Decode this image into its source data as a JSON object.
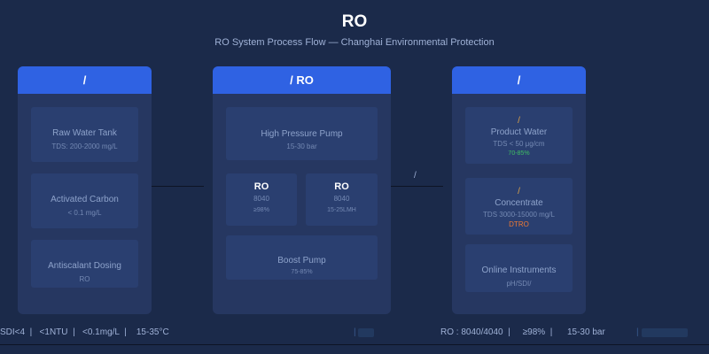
{
  "header": {
    "title": "RO",
    "subtitle": "RO System Process Flow — Changhai Environmental Protection"
  },
  "panels": {
    "left": {
      "title": "/",
      "items": [
        {
          "name": "Raw Water Tank",
          "spec": "TDS: 200-2000 mg/L"
        },
        {
          "name": "Activated Carbon",
          "spec": "< 0.1 mg/L"
        },
        {
          "name": "Antiscalant Dosing",
          "spec": "RO"
        }
      ]
    },
    "middle": {
      "title": "/ RO",
      "pump": {
        "name": "High Pressure Pump",
        "spec": "15-30 bar"
      },
      "ro1": {
        "name": "RO",
        "model": "8040",
        "spec": "≥98%"
      },
      "ro2": {
        "name": "RO",
        "model": "8040",
        "spec": "15-25LMH"
      },
      "boost": {
        "name": "Boost Pump",
        "spec": "75-85%"
      }
    },
    "right": {
      "title": "/",
      "product": {
        "mark": "/",
        "name": "Product Water",
        "spec": "TDS < 50 μg/cm",
        "extra": "70-85%"
      },
      "concentrate": {
        "mark": "/",
        "name": "Concentrate",
        "spec": "TDS 3000-15000 mg/L",
        "extra": "DTRO"
      },
      "instruments": {
        "name": "Online Instruments",
        "spec": "pH/SDI/"
      }
    }
  },
  "connector_label": "/",
  "footer": {
    "left": "SDI<4  |   <1NTU  |   <0.1mg/L  |    15-35°C",
    "left_bar": "|",
    "right": "RO : 8040/4040  |     ≥98%  |      15-30 bar",
    "right_bar": "|"
  },
  "colors": {
    "background": "#1b2a4a",
    "panel": "#263761",
    "panel_header": "#2f62e3",
    "box": "#2a3f70",
    "accent_green": "#3fbf63",
    "accent_orange": "#ee7a35",
    "accent_mark": "#e0a449"
  }
}
